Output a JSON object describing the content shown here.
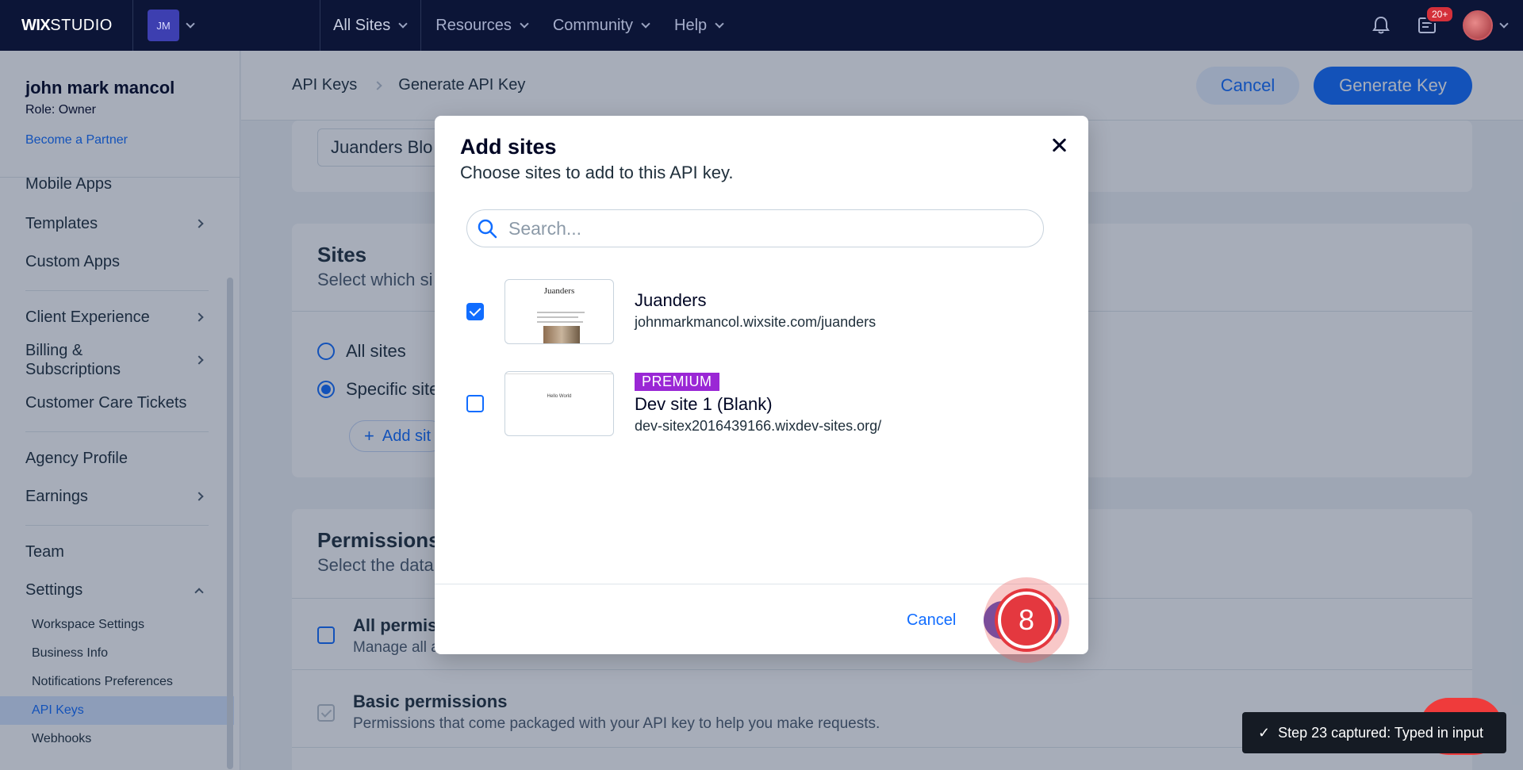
{
  "topbar": {
    "brand_bold": "WIX",
    "brand_light": "STUDIO",
    "workspace_initials": "JM",
    "all_sites": "All Sites",
    "nav": [
      "Resources",
      "Community",
      "Help"
    ],
    "notifications_badge": "20+"
  },
  "sidebar": {
    "user_name": "john mark mancol",
    "role": "Role: Owner",
    "partner_link": "Become a Partner",
    "items": {
      "mobile_apps": "Mobile Apps",
      "templates": "Templates",
      "custom_apps": "Custom Apps",
      "client_experience": "Client Experience",
      "billing": "Billing &\nSubscriptions",
      "customer_care": "Customer Care Tickets",
      "agency_profile": "Agency Profile",
      "earnings": "Earnings",
      "team": "Team",
      "settings": "Settings"
    },
    "settings_sub": {
      "workspace": "Workspace Settings",
      "business": "Business Info",
      "notifications": "Notifications Preferences",
      "api_keys": "API Keys",
      "webhooks": "Webhooks"
    }
  },
  "header": {
    "breadcrumb_root": "API Keys",
    "breadcrumb_current": "Generate API Key",
    "cancel": "Cancel",
    "generate": "Generate Key"
  },
  "form": {
    "key_name_value": "Juanders Blo",
    "sites_title": "Sites",
    "sites_sub": "Select which si",
    "all_sites": "All sites",
    "specific_sites": "Specific site",
    "add_sites": "Add sit",
    "permissions_title": "Permissions",
    "permissions_sub": "Select the data",
    "all_permissions": "All permiss",
    "all_permissions_sub": "Manage all a",
    "basic_permissions": "Basic permissions",
    "basic_permissions_sub": "Permissions that come packaged with your API key to help you make requests."
  },
  "modal": {
    "title": "Add sites",
    "subtitle": "Choose sites to add to this API key.",
    "search_placeholder": "Search...",
    "sites": [
      {
        "name": "Juanders",
        "url": "johnmarkmancol.wixsite.com/juanders",
        "checked": true,
        "badge": "",
        "thumb_title": "Juanders"
      },
      {
        "name": "Dev site 1 (Blank)",
        "url": "dev-sitex2016439166.wixdev-sites.org/",
        "checked": false,
        "badge": "PREMIUM",
        "thumb_title": "Hello World"
      }
    ],
    "cancel": "Cancel"
  },
  "step_marker": "8",
  "toast": {
    "text": "Step 23 captured: Typed in input",
    "check": "✓"
  }
}
